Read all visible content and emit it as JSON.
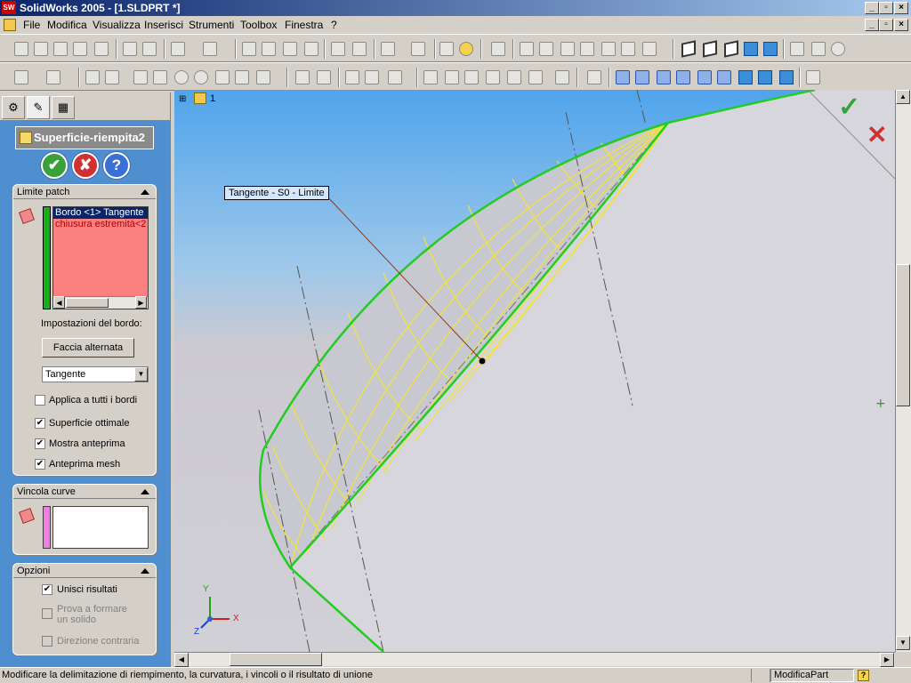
{
  "window": {
    "title": "SolidWorks 2005 - [1.SLDPRT *]",
    "app_icon": "SW"
  },
  "menu": [
    "File",
    "Modifica",
    "Visualizza",
    "Inserisci",
    "Strumenti",
    "Toolbox",
    "Finestra",
    "?"
  ],
  "tree": {
    "root_label": "1"
  },
  "feature": {
    "title": "Superficie-riempita2",
    "ok_icon": "check-icon",
    "cancel_icon": "close-icon",
    "help_icon": "help-icon"
  },
  "limite_patch": {
    "header": "Limite patch",
    "items": [
      "Bordo <1> Tangente",
      "chiusura estremità<2"
    ],
    "edge_settings_label": "Impostazioni del bordo:",
    "alternate_face_button": "Faccia alternata",
    "curvature_select": "Tangente",
    "apply_all": {
      "label": "Applica a tutti i bordi",
      "checked": false
    },
    "optimal_surface": {
      "label": "Superficie ottimale",
      "checked": true
    },
    "show_preview": {
      "label": "Mostra anteprima",
      "checked": true
    },
    "mesh_preview": {
      "label": "Anteprima mesh",
      "checked": true
    }
  },
  "vincola_curve": {
    "header": "Vincola curve"
  },
  "opzioni": {
    "header": "Opzioni",
    "merge": {
      "label": "Unisci risultati",
      "checked": true
    },
    "try_solid": {
      "label1": "Prova a formare",
      "label2": "un solido",
      "checked": false
    },
    "reverse": {
      "label": "Direzione contraria",
      "checked": false
    }
  },
  "viewport": {
    "tooltip": "Tangente - S0 - Limite",
    "axes": {
      "x": "X",
      "y": "Y",
      "z": "Z"
    },
    "colors": {
      "boundary": "#22cc22",
      "mesh": "#f0e43a",
      "leader": "#8b3a1a",
      "confirm_ok": "#3aa03a",
      "confirm_cancel": "#d03030"
    }
  },
  "status": {
    "message": "Modificare la delimitazione di riempimento, la curvatura, i vincoli o il risultato di unione",
    "mode": "ModificaPart",
    "help": "?"
  }
}
